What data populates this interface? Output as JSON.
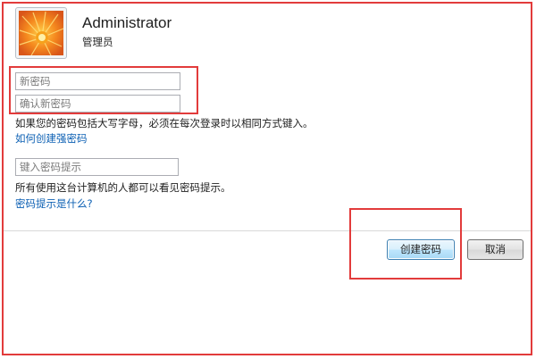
{
  "user": {
    "name": "Administrator",
    "role": "管理员"
  },
  "form": {
    "new_password_placeholder": "新密码",
    "confirm_password_placeholder": "确认新密码",
    "case_note": "如果您的密码包括大写字母，必须在每次登录时以相同方式键入。",
    "strong_password_link": "如何创建强密码",
    "hint_placeholder": "键入密码提示",
    "hint_note": "所有使用这台计算机的人都可以看见密码提示。",
    "hint_help_link": "密码提示是什么?"
  },
  "buttons": {
    "create": "创建密码",
    "cancel": "取消"
  },
  "colors": {
    "annotation_red": "#e23b3b",
    "link_blue": "#0b5fb3"
  },
  "icons": {
    "avatar": "orange-flower-avatar"
  }
}
